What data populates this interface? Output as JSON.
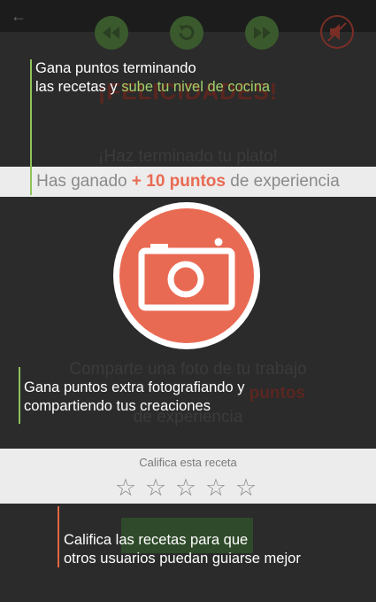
{
  "congrats_title": "¡FELICIDADES!",
  "finished_message": "¡Haz terminado tu plato!",
  "experience": {
    "prefix": "Has ganado ",
    "points": "+ 10 puntos",
    "suffix": " de experiencia"
  },
  "share": {
    "line1": "Comparte una foto de tu trabajo",
    "points": "puntos",
    "line3": "de experiencia"
  },
  "rating": {
    "label": "Califica esta receta",
    "stars_total": 5,
    "stars_value": 0
  },
  "callouts": {
    "levels": {
      "line1": "Gana puntos terminando",
      "line2_prefix": "las recetas y ",
      "line2_highlight": "sube tu nivel de cocina"
    },
    "photo": {
      "line1": "Gana puntos extra fotografiando y",
      "line2": "compartiendo tus creaciones"
    },
    "rate": {
      "line1": "Califica las recetas para que",
      "line2": "otros usuarios puedan guiarse mejor"
    }
  },
  "icons": {
    "back": "arrow-left-icon",
    "rewind": "rewind-icon",
    "replay": "replay-icon",
    "forward": "fast-forward-icon",
    "mute": "mute-icon",
    "camera": "camera-icon",
    "star": "star-outline-icon"
  },
  "colors": {
    "accent_orange": "#e96a53",
    "highlight_green": "#9fd16a",
    "control_green": "#3a5a2d"
  }
}
